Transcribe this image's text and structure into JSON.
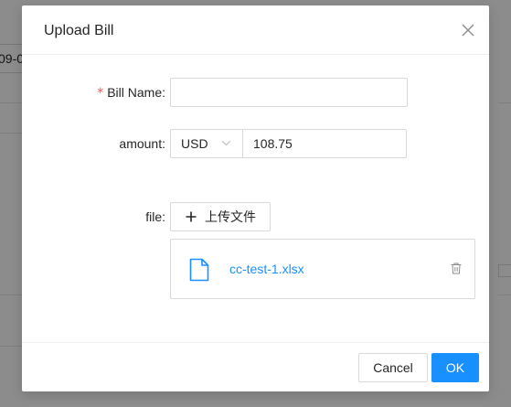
{
  "background": {
    "partial_field_text": "09-0"
  },
  "modal": {
    "title": "Upload Bill",
    "close_icon": "close-icon",
    "form": {
      "bill_name": {
        "required_mark": "*",
        "label": "Bill Name",
        "colon": ":",
        "value": ""
      },
      "amount": {
        "label": "amount",
        "colon": ":",
        "currency": "USD",
        "value": "108.75"
      },
      "file": {
        "label": "file",
        "colon": ":",
        "upload_label": "上传文件",
        "upload_icon": "plus-icon",
        "files": [
          {
            "name": "cc-test-1.xlsx",
            "icon": "file-icon",
            "delete_icon": "delete-icon"
          }
        ]
      }
    },
    "footer": {
      "cancel_label": "Cancel",
      "ok_label": "OK"
    },
    "colors": {
      "primary": "#1890ff",
      "required": "#ff4d4f",
      "border": "#d9d9d9"
    }
  }
}
